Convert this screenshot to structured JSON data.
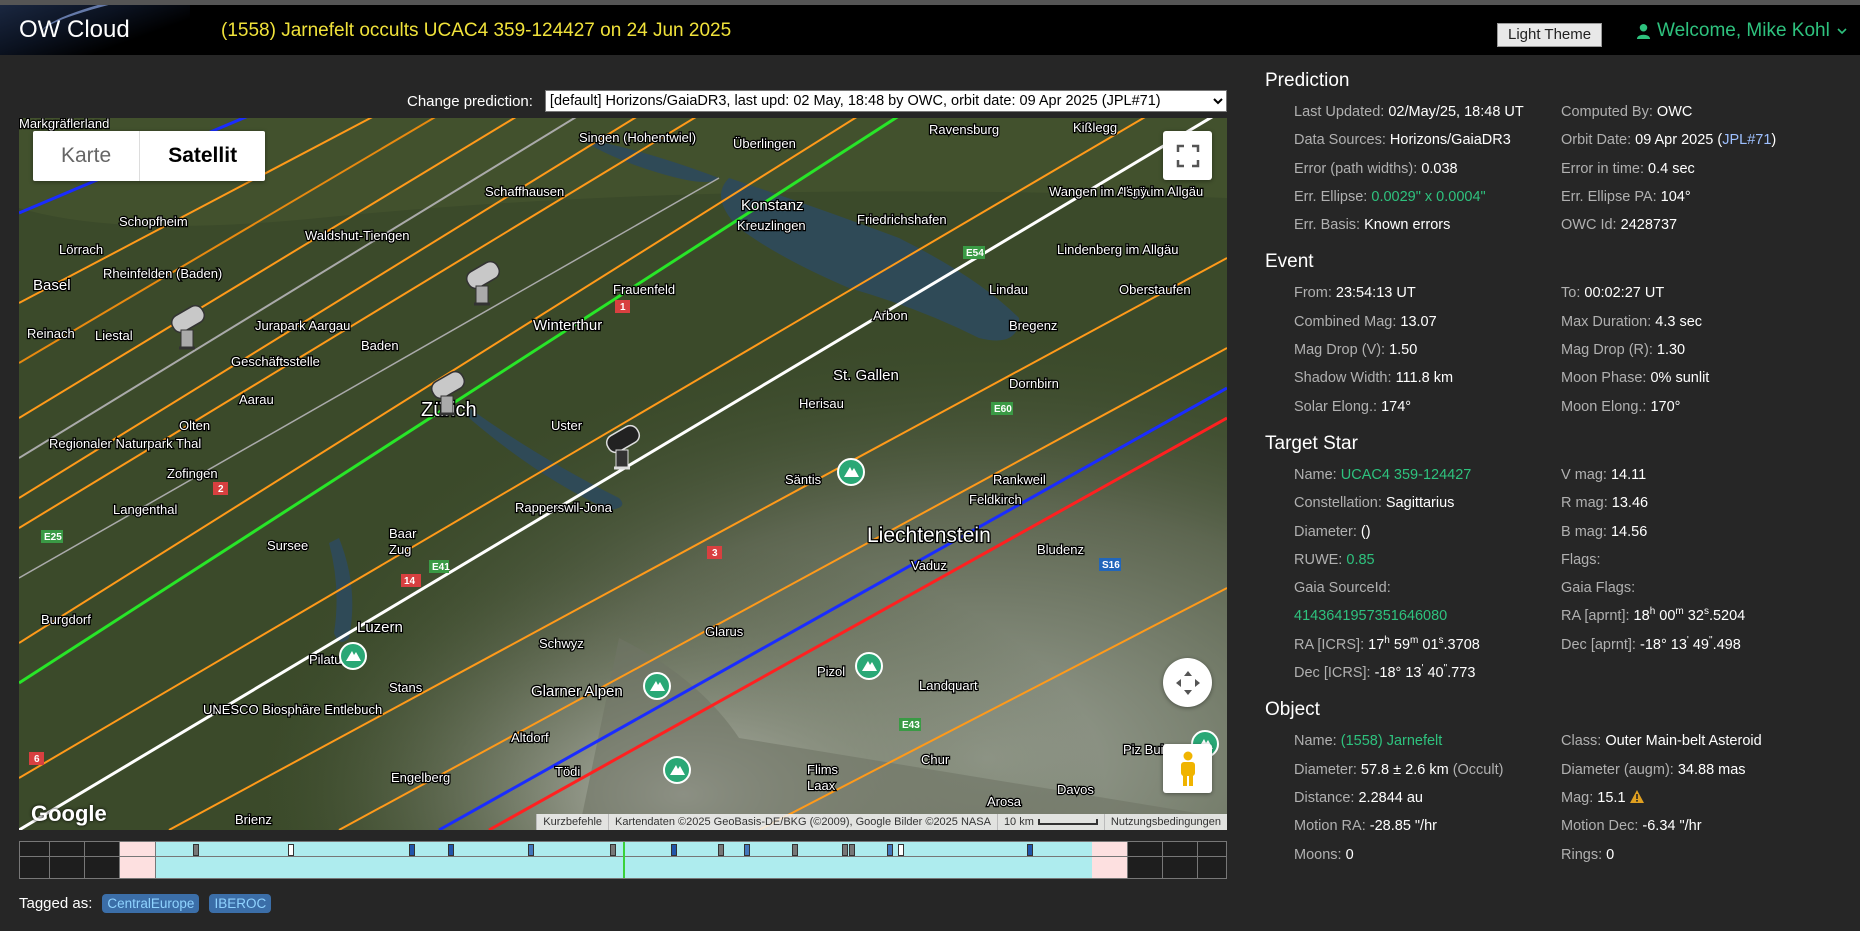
{
  "header": {
    "logo": "OW Cloud",
    "title": "(1558) Jarnefelt occults UCAC4 359-124427 on 24 Jun 2025",
    "theme_button": "Light Theme",
    "welcome": "Welcome, Mike Kohl"
  },
  "prediction_select": {
    "label": "Change prediction:",
    "selected": "[default] Horizons/GaiaDR3, last upd: 02 May, 18:48 by OWC, orbit date: 09 Apr 2025 (JPL#71)"
  },
  "map": {
    "type_karte": "Karte",
    "type_satellit": "Satellit",
    "google": "Google",
    "attribution": {
      "shortcuts": "Kurzbefehle",
      "data": "Kartendaten ©2025 GeoBasis-DE/BKG (©2009), Google Bilder ©2025 NASA",
      "scale": "10 km",
      "terms": "Nutzungsbedingungen"
    },
    "places": [
      {
        "label": "Markgräflerland"
      },
      {
        "label": "Schopfheim"
      },
      {
        "label": "Lörrach"
      },
      {
        "label": "Basel"
      },
      {
        "label": "Rheinfelden (Baden)"
      },
      {
        "label": "Reinach"
      },
      {
        "label": "Liestal"
      },
      {
        "label": "Waldshut-Tiengen"
      },
      {
        "label": "Singen (Hohentwiel)"
      },
      {
        "label": "Schaffhausen"
      },
      {
        "label": "Überlingen"
      },
      {
        "label": "Ravensburg"
      },
      {
        "label": "Kißlegg"
      },
      {
        "label": "Konstanz"
      },
      {
        "label": "Kreuzlingen"
      },
      {
        "label": "Friedrichshafen"
      },
      {
        "label": "Wangen im Allgäu"
      },
      {
        "label": "Isny im Allgäu"
      },
      {
        "label": "Frauenfeld"
      },
      {
        "label": "Lindenberg im Allgäu"
      },
      {
        "label": "Oberstaufen"
      },
      {
        "label": "Jurapark Aargau"
      },
      {
        "label": "Geschäftsstelle"
      },
      {
        "label": "Baden"
      },
      {
        "label": "Winterthur"
      },
      {
        "label": "Lindau"
      },
      {
        "label": "Arbon"
      },
      {
        "label": "Bregenz"
      },
      {
        "label": "Aarau"
      },
      {
        "label": "Zürich"
      },
      {
        "label": "St. Gallen"
      },
      {
        "label": "Dornbirn"
      },
      {
        "label": "Herisau"
      },
      {
        "label": "Olten"
      },
      {
        "label": "Uster"
      },
      {
        "label": "Regionaler Naturpark Thal"
      },
      {
        "label": "Zofingen"
      },
      {
        "label": "Säntis"
      },
      {
        "label": "Rankweil"
      },
      {
        "label": "Feldkirch"
      },
      {
        "label": "Langenthal"
      },
      {
        "label": "Rapperswil-Jona"
      },
      {
        "label": "Liechtenstein"
      },
      {
        "label": "Sursee"
      },
      {
        "label": "Baar"
      },
      {
        "label": "Zug"
      },
      {
        "label": "Bludenz"
      },
      {
        "label": "Vaduz"
      },
      {
        "label": "Burgdorf"
      },
      {
        "label": "Luzern"
      },
      {
        "label": "Glarus"
      },
      {
        "label": "Schwyz"
      },
      {
        "label": "Pilatus"
      },
      {
        "label": "Pizol"
      },
      {
        "label": "Landquart"
      },
      {
        "label": "Stans"
      },
      {
        "label": "Glarner Alpen"
      },
      {
        "label": "UNESCO Biosphäre Entlebuch"
      },
      {
        "label": "Altdorf"
      },
      {
        "label": "Chur"
      },
      {
        "label": "Piz Buin"
      },
      {
        "label": "Engelberg"
      },
      {
        "label": "Tödi"
      },
      {
        "label": "Flims"
      },
      {
        "label": "Laax"
      },
      {
        "label": "Arosa"
      },
      {
        "label": "Davos"
      },
      {
        "label": "Brienz"
      }
    ],
    "road_badges": [
      "E25",
      "E41",
      "E43",
      "E60",
      "E54",
      "S16",
      "1",
      "2",
      "3",
      "6",
      "14"
    ]
  },
  "tagged": {
    "label": "Tagged as:",
    "tags": [
      "CentralEurope",
      "IBEROC"
    ]
  },
  "prediction": {
    "heading": "Prediction",
    "last_updated_label": "Last Updated:",
    "last_updated": "02/May/25, 18:48 UT",
    "computed_by_label": "Computed By:",
    "computed_by": "OWC",
    "data_sources_label": "Data Sources:",
    "data_sources": "Horizons/GaiaDR3",
    "orbit_date_label": "Orbit Date:",
    "orbit_date": "09 Apr 2025 (",
    "orbit_jpl": "JPL#71",
    "orbit_close": ")",
    "error_path_label": "Error (path widths):",
    "error_path": "0.038",
    "error_time_label": "Error in time:",
    "error_time": "0.4 sec",
    "err_ellipse_label": "Err. Ellipse:",
    "err_ellipse": "0.0029\" x 0.0004\"",
    "err_ellipse_pa_label": "Err. Ellipse PA:",
    "err_ellipse_pa": "104°",
    "err_basis_label": "Err. Basis:",
    "err_basis": "Known errors",
    "owc_id_label": "OWC Id:",
    "owc_id": "2428737"
  },
  "event": {
    "heading": "Event",
    "from_label": "From:",
    "from": "23:54:13 UT",
    "to_label": "To:",
    "to": "00:02:27 UT",
    "combined_mag_label": "Combined Mag:",
    "combined_mag": "13.07",
    "max_duration_label": "Max Duration:",
    "max_duration": "4.3 sec",
    "mag_drop_v_label": "Mag Drop (V):",
    "mag_drop_v": "1.50",
    "mag_drop_r_label": "Mag Drop (R):",
    "mag_drop_r": "1.30",
    "shadow_width_label": "Shadow Width:",
    "shadow_width": "111.8 km",
    "moon_phase_label": "Moon Phase:",
    "moon_phase": "0% sunlit",
    "solar_elong_label": "Solar Elong.:",
    "solar_elong": "174°",
    "moon_elong_label": "Moon Elong.:",
    "moon_elong": "170°"
  },
  "target_star": {
    "heading": "Target Star",
    "name_label": "Name:",
    "name": "UCAC4 359-124427",
    "vmag_label": "V mag:",
    "vmag": "14.11",
    "constellation_label": "Constellation:",
    "constellation": "Sagittarius",
    "rmag_label": "R mag:",
    "rmag": "13.46",
    "diameter_label": "Diameter:",
    "diameter": " ()",
    "bmag_label": "B mag:",
    "bmag": "14.56",
    "ruwe_label": "RUWE:",
    "ruwe": "0.85",
    "flags_label": "Flags:",
    "gaia_source_label": "Gaia SourceId:",
    "gaia_flags_label": "Gaia Flags:",
    "gaia_source": "4143641957351646080",
    "ra_aprnt_label": "RA [aprnt]:",
    "ra_aprnt_h": "18",
    "ra_aprnt_m": "00",
    "ra_aprnt_s": "32",
    "ra_aprnt_frac": ".5204",
    "ra_icrs_label": "RA [ICRS]:",
    "ra_icrs_h": "17",
    "ra_icrs_m": "59",
    "ra_icrs_s": "01",
    "ra_icrs_frac": ".3708",
    "dec_aprnt_label": "Dec [aprnt]:",
    "dec_aprnt_d": "-18° 13",
    "dec_aprnt_m": "49",
    "dec_aprnt_frac": ".498",
    "dec_icrs_label": "Dec [ICRS]:",
    "dec_icrs_d": "-18° 13",
    "dec_icrs_m": "40",
    "dec_icrs_frac": ".773"
  },
  "object": {
    "heading": "Object",
    "name_label": "Name:",
    "name": "(1558) Jarnefelt",
    "class_label": "Class:",
    "class": "Outer Main-belt Asteroid",
    "diameter_label": "Diameter:",
    "diameter": "57.8 ± 2.6 km",
    "diameter_src": "(Occult)",
    "diameter_augm_label": "Diameter (augm):",
    "diameter_augm": "34.88 mas",
    "distance_label": "Distance:",
    "distance": "2.2844 au",
    "mag_label": "Mag:",
    "mag": "15.1",
    "motion_ra_label": "Motion RA:",
    "motion_ra": "-28.85 \"/hr",
    "motion_dec_label": "Motion Dec:",
    "motion_dec": "-6.34 \"/hr",
    "moons_label": "Moons:",
    "moons": "0",
    "rings_label": "Rings:",
    "rings": "0"
  },
  "colors": {
    "title": "#f0e23a",
    "accent_green": "#2ec27e",
    "centerline": "#ffffff",
    "path_limits": "#28e628",
    "error_lines": "#ff9a1a",
    "sigma_lines": "#1a2cff",
    "sigma3_lines": "#ff2020"
  }
}
